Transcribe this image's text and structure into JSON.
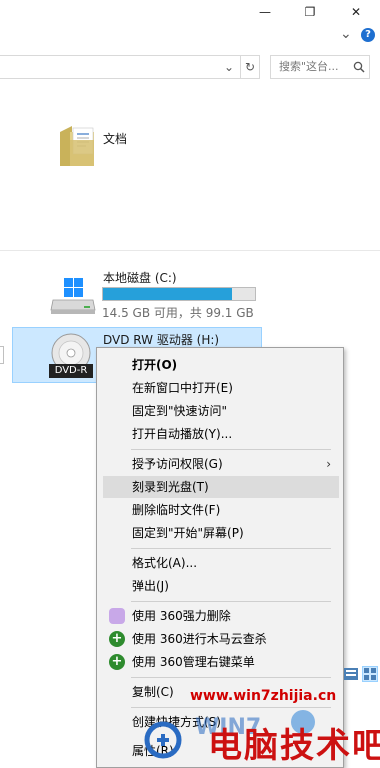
{
  "window": {
    "minimize_glyph": "—",
    "maximize_glyph": "❐",
    "close_glyph": "✕",
    "ribbon_toggle_glyph": "⌄",
    "help_glyph": "?"
  },
  "address": {
    "dropdown_glyph": "⌄",
    "refresh_glyph": "↻",
    "search_placeholder": "搜索\"这台..."
  },
  "folders": [
    {
      "name": "文档",
      "icon": "documents-folder-icon"
    }
  ],
  "drives": [
    {
      "name": "本地磁盘 (C:)",
      "space": "14.5 GB 可用，共 99.1 GB",
      "used_fraction": 0.85,
      "icon": "hard-drive-icon"
    },
    {
      "name": "DVD RW 驱动器 (H:)",
      "badge": "DVD-R",
      "icon": "dvd-drive-icon"
    }
  ],
  "context_menu": {
    "items": [
      {
        "label": "打开(O)",
        "bold": true
      },
      {
        "label": "在新窗口中打开(E)"
      },
      {
        "label": "固定到\"快速访问\""
      },
      {
        "label": "打开自动播放(Y)..."
      },
      {
        "label": "授予访问权限(G)",
        "submenu": true
      },
      {
        "label": "刻录到光盘(T)",
        "highlighted": true
      },
      {
        "label": "删除临时文件(F)"
      },
      {
        "label": "固定到\"开始\"屏幕(P)"
      },
      {
        "label": "格式化(A)..."
      },
      {
        "label": "弹出(J)"
      },
      {
        "label": "使用 360强力删除",
        "icon": "360-shred-icon"
      },
      {
        "label": "使用 360进行木马云查杀",
        "icon": "360-scan-icon"
      },
      {
        "label": "使用 360管理右键菜单",
        "icon": "360-manage-icon"
      },
      {
        "label": "复制(C)"
      },
      {
        "label": "创建快捷方式(S)"
      },
      {
        "label": "属性(R)"
      }
    ],
    "submenu_arrow": "›"
  },
  "watermark": {
    "url": "www.win7zhijia.cn",
    "text": "电脑技术吧"
  },
  "colors": {
    "selection": "#cce8ff",
    "drive_bar": "#26a0da",
    "watermark": "#d10000"
  }
}
